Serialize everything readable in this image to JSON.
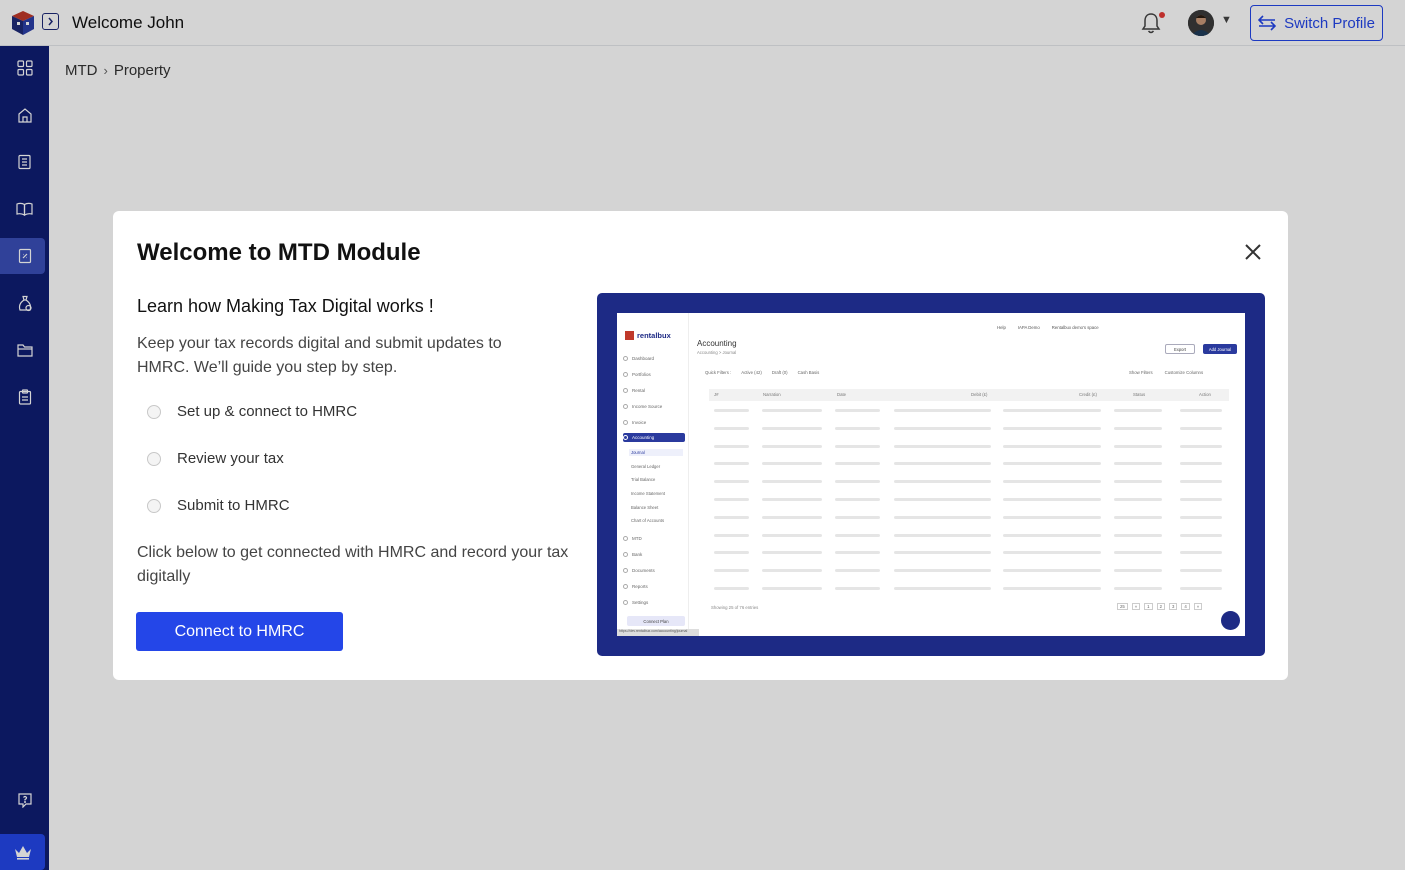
{
  "header": {
    "welcome_text": "Welcome John",
    "switch_profile_label": "Switch Profile"
  },
  "breadcrumb": {
    "items": [
      "MTD",
      "Property"
    ]
  },
  "sidebar": {
    "icons": [
      "dashboard-grid-icon",
      "home-icon",
      "ledger-icon",
      "book-icon",
      "tax-document-icon",
      "money-bag-icon",
      "folder-icon",
      "clipboard-icon",
      "help-icon",
      "crown-icon"
    ],
    "active": "tax-document-icon"
  },
  "modal": {
    "title": "Welcome to MTD Module",
    "learn_title": "Learn how Making Tax Digital works !",
    "intro": "Keep your tax records digital and submit updates to HMRC. We’ll guide you step by step.",
    "steps": [
      "Set up & connect to HMRC",
      "Review your tax",
      "Submit to HMRC"
    ],
    "cta_text": "Click  below to get connected with HMRC and record your tax digitally",
    "connect_button": "Connect to HMRC"
  },
  "preview": {
    "brand": "rentalbux",
    "topbar": [
      "Help",
      "IAPA Demo",
      "Rentalbux demo's space"
    ],
    "nav": [
      "Dashboard",
      "Portfolios",
      "Rental",
      "Income Source",
      "Invoice",
      "Accounting"
    ],
    "accounting_sub": [
      "Journal",
      "General Ledger",
      "Trial Balance",
      "Income Statement",
      "Balance Sheet",
      "Chart of Accounts"
    ],
    "nav_lower": [
      "MTD",
      "Bank",
      "Documents",
      "Reports",
      "Settings"
    ],
    "connect_label": "Connect Plan",
    "url": "https://dev.rentalbux.com/accounting/journal",
    "page_title": "Accounting",
    "breadcrumb": "Accounting  >  Journal",
    "export_label": "Export",
    "add_label": "Add Journal",
    "quick_filters_label": "Quick Filters :",
    "filters": [
      "Active (42)",
      "Draft (0)",
      "Cash Basis"
    ],
    "right_filters": [
      "Show Filters",
      "Customize Columns"
    ],
    "columns": [
      "J#",
      "Narration",
      "Date",
      "Debit (£)",
      "Credit (£)",
      "Status",
      "Action"
    ],
    "showing": "Showing 25 of 76 entries",
    "page_size": "25",
    "pages": [
      "«",
      "1",
      "2",
      "3",
      "4",
      "»"
    ]
  },
  "colors": {
    "primary": "#2446e8",
    "sidebar": "#0f1d73",
    "preview_frame": "#1d2a85",
    "notification": "#e53935"
  }
}
